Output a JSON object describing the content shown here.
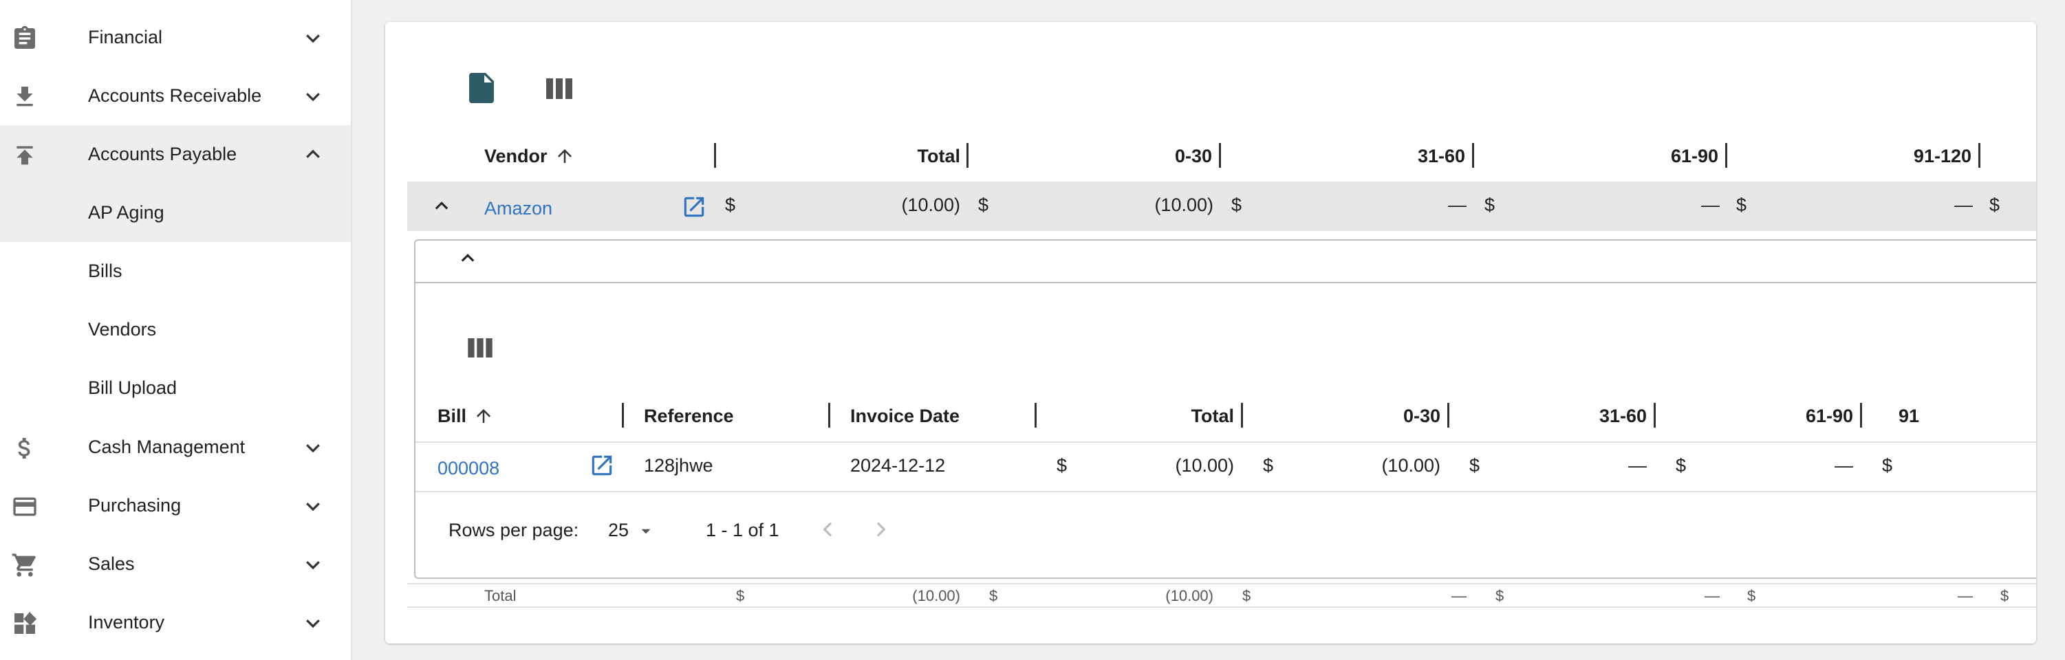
{
  "sidebar": {
    "items": [
      {
        "label": "Financial",
        "icon": "clipboard-icon",
        "state": "collapsed"
      },
      {
        "label": "Accounts Receivable",
        "icon": "download-icon",
        "state": "collapsed"
      },
      {
        "label": "Accounts Payable",
        "icon": "upload-icon",
        "state": "expanded"
      },
      {
        "label": "AP Aging",
        "sub": true,
        "active": true
      },
      {
        "label": "Bills",
        "sub": true
      },
      {
        "label": "Vendors",
        "sub": true
      },
      {
        "label": "Bill Upload",
        "sub": true
      },
      {
        "label": "Cash Management",
        "icon": "dollar-icon",
        "state": "collapsed"
      },
      {
        "label": "Purchasing",
        "icon": "credit-card-icon",
        "state": "collapsed"
      },
      {
        "label": "Sales",
        "icon": "cart-icon",
        "state": "collapsed"
      },
      {
        "label": "Inventory",
        "icon": "widgets-icon",
        "state": "collapsed"
      }
    ]
  },
  "report": {
    "toolbar": {
      "export_icon": "document-icon",
      "columns_icon": "columns-icon"
    },
    "columns": [
      "Vendor",
      "Total",
      "0-30",
      "31-60",
      "61-90",
      "91-120"
    ],
    "vendor_row": {
      "name": "Amazon",
      "currency": "$",
      "total": "(10.00)",
      "d0_30": "(10.00)",
      "d31_60": "—",
      "d61_90": "—",
      "d91_120": "—"
    },
    "bills": {
      "columns": [
        "Bill",
        "Reference",
        "Invoice Date",
        "Total",
        "0-30",
        "31-60",
        "61-90",
        "91"
      ],
      "rows": [
        {
          "bill": "000008",
          "reference": "128jhwe",
          "invoice_date": "2024-12-12",
          "currency": "$",
          "total": "(10.00)",
          "d0_30": "(10.00)",
          "d31_60": "—",
          "d61_90": "—"
        }
      ],
      "pagination": {
        "rows_per_page_label": "Rows per page:",
        "rows_per_page": "25",
        "range": "1 - 1 of 1"
      }
    },
    "totals_row": {
      "label": "Total",
      "currency": "$",
      "total": "(10.00)",
      "d0_30": "(10.00)",
      "d31_60": "—",
      "d61_90": "—",
      "d91_120": "—"
    }
  },
  "colors": {
    "accent": "#2f74c0",
    "icon_teal": "#2e5a66",
    "row_highlight": "#e6e6e6"
  }
}
